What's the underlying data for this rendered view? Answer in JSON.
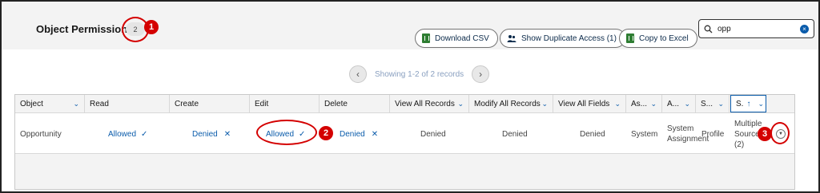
{
  "header": {
    "title": "Object Permissions",
    "count": "2",
    "buttons": {
      "download_csv": "Download CSV",
      "show_duplicate": "Show Duplicate Access (1)",
      "copy_excel": "Copy to Excel"
    },
    "search_value": "opp"
  },
  "pager": {
    "text": "Showing 1-2 of 2 records"
  },
  "columns": [
    "Object",
    "Read",
    "Create",
    "Edit",
    "Delete",
    "View All Records",
    "Modify All Records",
    "View All Fields",
    "As...",
    "A...",
    "S...",
    "S."
  ],
  "row": {
    "object": "Opportunity",
    "read": "Allowed",
    "create": "Denied",
    "edit": "Allowed",
    "delete": "Denied",
    "view_all_records": "Denied",
    "modify_all_records": "Denied",
    "view_all_fields": "Denied",
    "assignment": "System",
    "a_col": "System Assignment",
    "s_col": "Profile",
    "source": "Multiple Sources (2)"
  },
  "annotations": [
    "1",
    "2",
    "3"
  ],
  "colors": {
    "accent": "#0b5cab",
    "annotation": "#d40000"
  }
}
